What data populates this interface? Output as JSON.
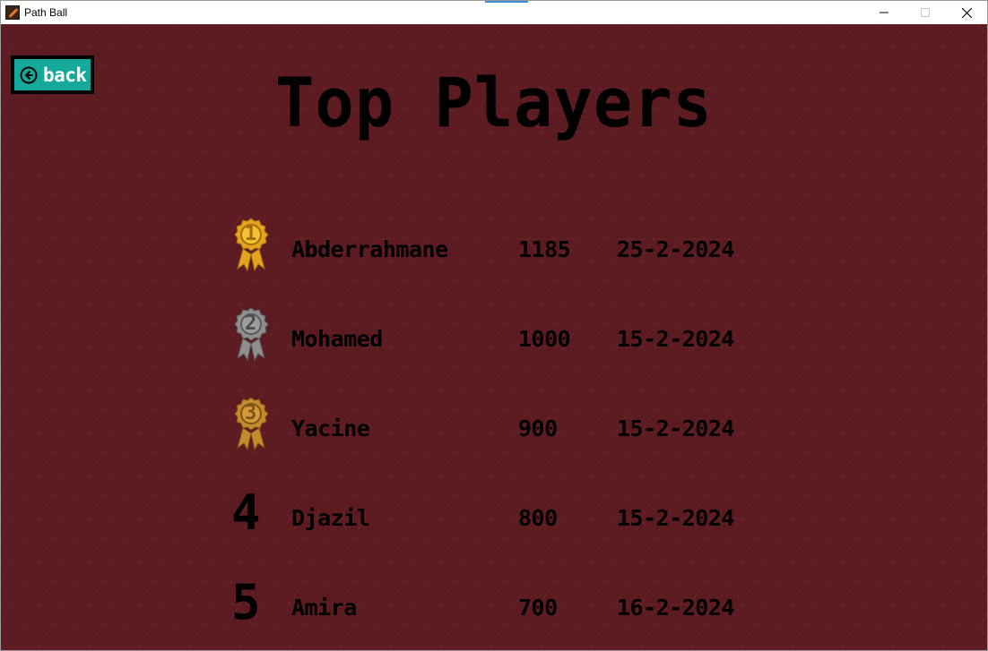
{
  "window": {
    "title": "Path Ball",
    "controls": [
      "minimize-icon",
      "maximize-icon",
      "close-icon"
    ]
  },
  "colors": {
    "background": "#5c1a21",
    "back_button": "#14a99a",
    "gold": "#e5a31f",
    "silver": "#8e8e8e",
    "bronze": "#c48a2e",
    "text": "#000000"
  },
  "back_button": {
    "icon": "circle-arrow-left-icon",
    "label": "back"
  },
  "page_title": "Top Players",
  "players": [
    {
      "rank": "1",
      "badge": "gold-medal-icon",
      "name": "Abderrahmane",
      "score": "1185",
      "date": "25-2-2024"
    },
    {
      "rank": "2",
      "badge": "silver-medal-icon",
      "name": "Mohamed",
      "score": "1000",
      "date": "15-2-2024"
    },
    {
      "rank": "3",
      "badge": "bronze-medal-icon",
      "name": "Yacine",
      "score": "900",
      "date": "15-2-2024"
    },
    {
      "rank": "4",
      "badge": "",
      "name": "Djazil",
      "score": "800",
      "date": "15-2-2024"
    },
    {
      "rank": "5",
      "badge": "",
      "name": "Amira",
      "score": "700",
      "date": "16-2-2024"
    }
  ]
}
